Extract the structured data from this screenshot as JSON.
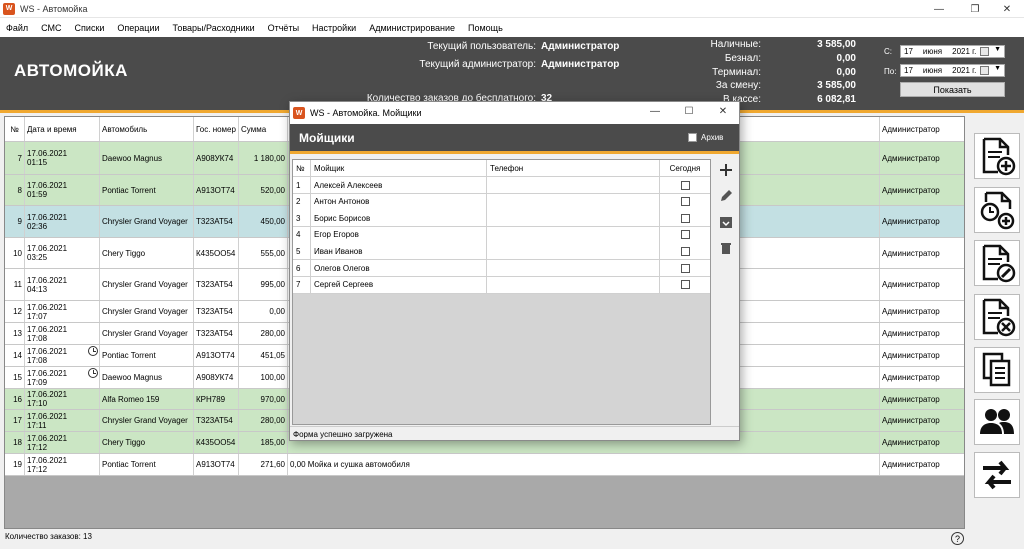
{
  "window": {
    "title": "WS - Автомойка"
  },
  "menu": [
    "Файл",
    "СМС",
    "Списки",
    "Операции",
    "Товары/Расходники",
    "Отчёты",
    "Настройки",
    "Администрирование",
    "Помощь"
  ],
  "header": {
    "title": "АВТОМОЙКА",
    "current_user_label": "Текущий пользователь:",
    "current_user": "Администратор",
    "current_admin_label": "Текущий администратор:",
    "current_admin": "Администратор",
    "free_orders_label": "Количество заказов до бесплатного:",
    "free_orders": "32",
    "cash_label": "Наличные:",
    "cash": "3 585,00",
    "cashless_label": "Безнал:",
    "cashless": "0,00",
    "terminal_label": "Терминал:",
    "terminal": "0,00",
    "shift_label": "За смену:",
    "shift": "3 585,00",
    "register_label": "В кассе:",
    "register": "6 082,81",
    "from_label": "С:",
    "from_day": "17",
    "from_month": "июня",
    "from_year": "2021 г.",
    "to_label": "По:",
    "to_day": "17",
    "to_month": "июня",
    "to_year": "2021 г.",
    "show_button": "Показать"
  },
  "table": {
    "columns": [
      "№",
      "Дата и время",
      "Автомобиль",
      "Гос. номер",
      "Сумма",
      "Администратор"
    ],
    "rows": [
      {
        "n": "7",
        "date": "17.06.2021",
        "time": "01:15",
        "car": "Daewoo Magnus",
        "plate": "А908УК74",
        "sum": "1 180,00",
        "extra": "",
        "admin": "Администратор",
        "color": "green"
      },
      {
        "n": "8",
        "date": "17.06.2021",
        "time": "01:59",
        "car": "Pontiac Torrent",
        "plate": "А913ОТ74",
        "sum": "520,00",
        "extra": "",
        "admin": "Администратор",
        "color": "green"
      },
      {
        "n": "9",
        "date": "17.06.2021",
        "time": "02:36",
        "car": "Chrysler Grand Voyager",
        "plate": "Т323АТ54",
        "sum": "450,00",
        "extra": "",
        "admin": "Администратор",
        "color": "blue"
      },
      {
        "n": "10",
        "date": "17.06.2021",
        "time": "03:25",
        "car": "Chery Tiggo",
        "plate": "К435ОО54",
        "sum": "555,00",
        "extra": "",
        "admin": "Администратор",
        "color": "white"
      },
      {
        "n": "11",
        "date": "17.06.2021",
        "time": "04:13",
        "car": "Chrysler Grand Voyager",
        "plate": "Т323АТ54",
        "sum": "995,00",
        "extra": "",
        "admin": "Администратор",
        "color": "white"
      },
      {
        "n": "12",
        "date": "17.06.2021",
        "time": "17:07",
        "car": "Chrysler Grand Voyager",
        "plate": "Т323АТ54",
        "sum": "0,00",
        "extra": "",
        "admin": "Администратор",
        "color": "white"
      },
      {
        "n": "13",
        "date": "17.06.2021",
        "time": "17:08",
        "car": "Chrysler Grand Voyager",
        "plate": "Т323АТ54",
        "sum": "280,00",
        "extra": "",
        "admin": "Администратор",
        "color": "white"
      },
      {
        "n": "14",
        "date": "17.06.2021",
        "time": "17:08",
        "car": "Pontiac Torrent",
        "plate": "А913ОТ74",
        "sum": "451,05",
        "extra": "",
        "admin": "Администратор",
        "color": "white",
        "clock": true
      },
      {
        "n": "15",
        "date": "17.06.2021",
        "time": "17:09",
        "car": "Daewoo Magnus",
        "plate": "А908УК74",
        "sum": "100,00",
        "extra": "",
        "admin": "Администратор",
        "color": "white",
        "clock": true
      },
      {
        "n": "16",
        "date": "17.06.2021",
        "time": "17:10",
        "car": "Alfa Romeo 159",
        "plate": "КРН789",
        "sum": "970,00",
        "extra": "",
        "admin": "Администратор",
        "color": "green"
      },
      {
        "n": "17",
        "date": "17.06.2021",
        "time": "17:11",
        "car": "Chrysler Grand Voyager",
        "plate": "Т323АТ54",
        "sum": "280,00",
        "extra": "",
        "admin": "Администратор",
        "color": "green"
      },
      {
        "n": "18",
        "date": "17.06.2021",
        "time": "17:12",
        "car": "Chery Tiggo",
        "plate": "К435ОО54",
        "sum": "185,00",
        "extra": "",
        "admin": "Администратор",
        "color": "green"
      },
      {
        "n": "19",
        "date": "17.06.2021",
        "time": "17:12",
        "car": "Pontiac Torrent",
        "plate": "А913ОТ74",
        "sum": "271,60",
        "extra": "0,00  Мойка и сушка автомобиля",
        "admin": "Администратор",
        "color": "white"
      }
    ]
  },
  "status": {
    "orders_count": "Количество заказов: 13",
    "help": "?"
  },
  "dialog": {
    "title": "WS - Автомойка. Мойщики",
    "header": "Мойщики",
    "archive_label": "Архив",
    "columns": [
      "№",
      "Мойщик",
      "Телефон",
      "Сегодня"
    ],
    "rows": [
      {
        "n": "1",
        "name": "Алексей Алексеев",
        "phone": ""
      },
      {
        "n": "2",
        "name": "Антон Антонов",
        "phone": ""
      },
      {
        "n": "3",
        "name": "Борис Борисов",
        "phone": ""
      },
      {
        "n": "4",
        "name": "Егор Егоров",
        "phone": ""
      },
      {
        "n": "5",
        "name": "Иван Иванов",
        "phone": ""
      },
      {
        "n": "6",
        "name": "Олегов Олегов",
        "phone": ""
      },
      {
        "n": "7",
        "name": "Сергей Сергеев",
        "phone": ""
      }
    ],
    "status": "Форма успешно загружена"
  }
}
